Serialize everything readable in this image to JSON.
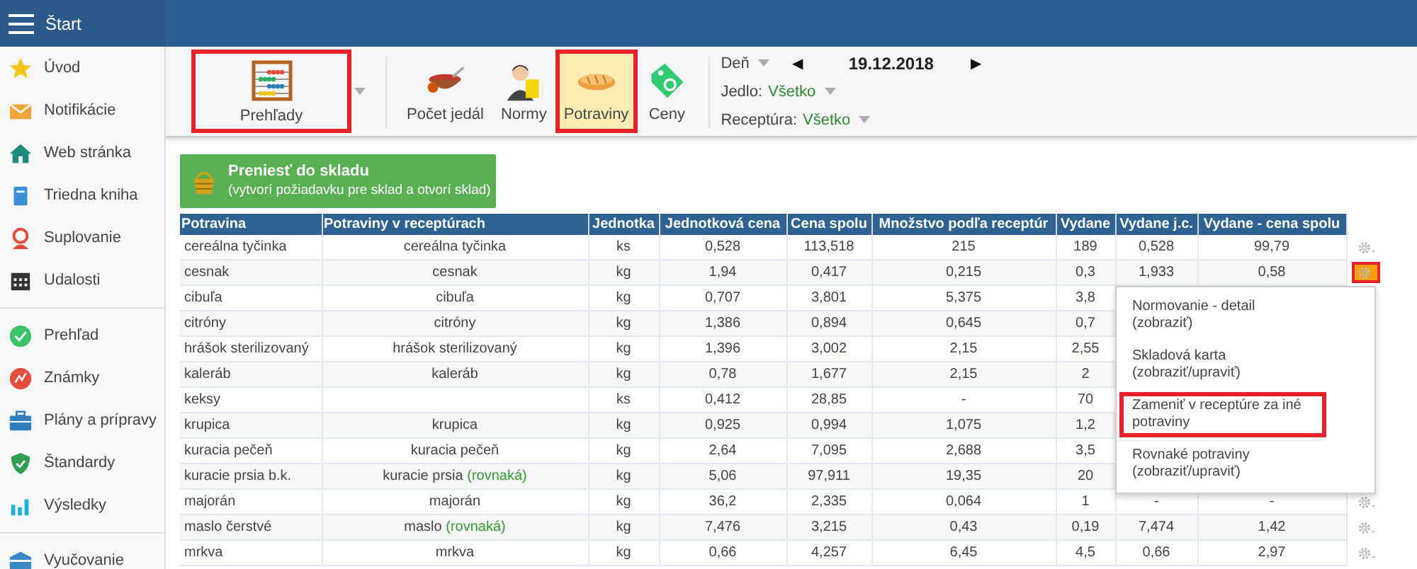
{
  "topbar": {
    "title": "Štart"
  },
  "sidebar": {
    "groups": [
      {
        "items": [
          {
            "label": "Úvod"
          },
          {
            "label": "Notifikácie"
          },
          {
            "label": "Web stránka"
          },
          {
            "label": "Triedna kniha"
          },
          {
            "label": "Suplovanie"
          },
          {
            "label": "Udalosti"
          }
        ]
      },
      {
        "items": [
          {
            "label": "Prehľad"
          },
          {
            "label": "Známky"
          },
          {
            "label": "Plány a prípravy"
          },
          {
            "label": "Štandardy"
          },
          {
            "label": "Výsledky"
          }
        ]
      },
      {
        "items": [
          {
            "label": "Vyučovanie"
          }
        ]
      }
    ]
  },
  "toolbar": {
    "reports": {
      "label": "Prehľady",
      "highlighted": true
    },
    "tools": [
      {
        "label": "Počet jedál",
        "selected": false,
        "highlighted": false
      },
      {
        "label": "Normy",
        "selected": false,
        "highlighted": false
      },
      {
        "label": "Potraviny",
        "selected": true,
        "highlighted": true
      },
      {
        "label": "Ceny",
        "selected": false,
        "highlighted": false
      }
    ]
  },
  "filters": {
    "day": {
      "label": "Deň",
      "prev": "◀",
      "date": "19.12.2018",
      "next": "▶"
    },
    "meal": {
      "label": "Jedlo:",
      "value": "Všetko"
    },
    "recipe": {
      "label": "Receptúra:",
      "value": "Všetko"
    }
  },
  "transfer_button": {
    "title": "Preniesť do skladu",
    "subtitle": "(vytvorí požiadavku pre sklad a otvorí sklad)"
  },
  "table": {
    "columns": [
      "Potravina",
      "Potraviny v receptúrach",
      "Jednotka",
      "Jednotková cena",
      "Cena spolu",
      "Množstvo podľa receptúr",
      "Vydane",
      "Vydane j.c.",
      "Vydane - cena spolu"
    ],
    "rows": [
      {
        "cells": [
          "cereálna tyčinka",
          "cereálna tyčinka",
          "ks",
          "0,528",
          "113,518",
          "215",
          "189",
          "0,528",
          "99,79"
        ],
        "menu_open": false
      },
      {
        "cells": [
          "cesnak",
          "cesnak",
          "kg",
          "1,94",
          "0,417",
          "0,215",
          "0,3",
          "1,933",
          "0,58"
        ],
        "menu_open": true
      },
      {
        "cells": [
          "cibuľa",
          "cibuľa",
          "kg",
          "0,707",
          "3,801",
          "5,375",
          "3,8"
        ]
      },
      {
        "cells": [
          "citróny",
          "citróny",
          "kg",
          "1,386",
          "0,894",
          "0,645",
          "0,7"
        ]
      },
      {
        "cells": [
          "hrášok sterilizovaný",
          "hrášok sterilizovaný",
          "kg",
          "1,396",
          "3,002",
          "2,15",
          "2,55"
        ]
      },
      {
        "cells": [
          "kaleráb",
          "kaleráb",
          "kg",
          "0,78",
          "1,677",
          "2,15",
          "2"
        ]
      },
      {
        "cells": [
          "keksy",
          "",
          "ks",
          "0,412",
          "28,85",
          "-",
          "70"
        ]
      },
      {
        "cells": [
          "krupica",
          "krupica",
          "kg",
          "0,925",
          "0,994",
          "1,075",
          "1,2"
        ]
      },
      {
        "cells": [
          "kuracia pečeň",
          "kuracia pečeň",
          "kg",
          "2,64",
          "7,095",
          "2,688",
          "3,5"
        ]
      },
      {
        "cells": [
          "kuracie prsia b.k.",
          "kuracie prsia",
          "kg",
          "5,06",
          "97,911",
          "19,35",
          "20"
        ],
        "note": "(rovnaká)"
      },
      {
        "cells": [
          "majorán",
          "majorán",
          "kg",
          "36,2",
          "2,335",
          "0,064",
          "1",
          "-",
          "-"
        ],
        "menu_open": false
      },
      {
        "cells": [
          "maslo čerstvé",
          "maslo",
          "kg",
          "7,476",
          "3,215",
          "0,43",
          "0,19",
          "7,474",
          "1,42"
        ],
        "note": "(rovnaká)",
        "menu_open": false
      },
      {
        "cells": [
          "mrkva",
          "mrkva",
          "kg",
          "0,66",
          "4,257",
          "6,45",
          "4,5",
          "0,66",
          "2,97"
        ],
        "menu_open": false
      }
    ]
  },
  "context_menu": {
    "items": [
      {
        "label": "Normovanie - detail",
        "note": "(zobraziť)",
        "highlighted": false
      },
      {
        "label": "Skladová karta",
        "note": "(zobraziť/upraviť)",
        "highlighted": false
      },
      {
        "label": "Zameniť v receptúre za iné potraviny",
        "highlighted": true
      },
      {
        "label": "Rovnaké potraviny",
        "note": "(zobraziť/upraviť)",
        "highlighted": false
      }
    ]
  }
}
